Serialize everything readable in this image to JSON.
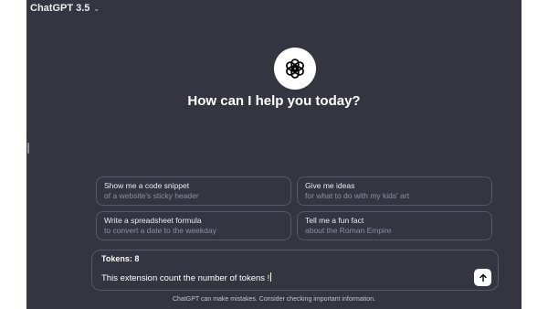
{
  "header": {
    "model_name": "ChatGPT 3.5",
    "chevron_icon": "chevron-down-icon"
  },
  "main": {
    "logo_icon": "openai-logo-icon",
    "headline": "How can I help you today?",
    "suggestions": [
      {
        "title": "Show me a code snippet",
        "subtitle": "of a website's sticky header"
      },
      {
        "title": "Give me ideas",
        "subtitle": "for what to do with my kids' art"
      },
      {
        "title": "Write a spreadsheet formula",
        "subtitle": "to convert a date to the weekday"
      },
      {
        "title": "Tell me a fun fact",
        "subtitle": "about the Roman Empire"
      }
    ]
  },
  "composer": {
    "tokens_label": "Tokens: 8",
    "input_value": "This extension count the number of tokens !",
    "send_icon": "arrow-up-icon"
  },
  "footer": {
    "disclaimer": "ChatGPT can make mistakes. Consider checking important information."
  },
  "colors": {
    "background": "#343541",
    "border": "#565869",
    "text": "#ececf1",
    "muted": "#8e8ea0"
  }
}
